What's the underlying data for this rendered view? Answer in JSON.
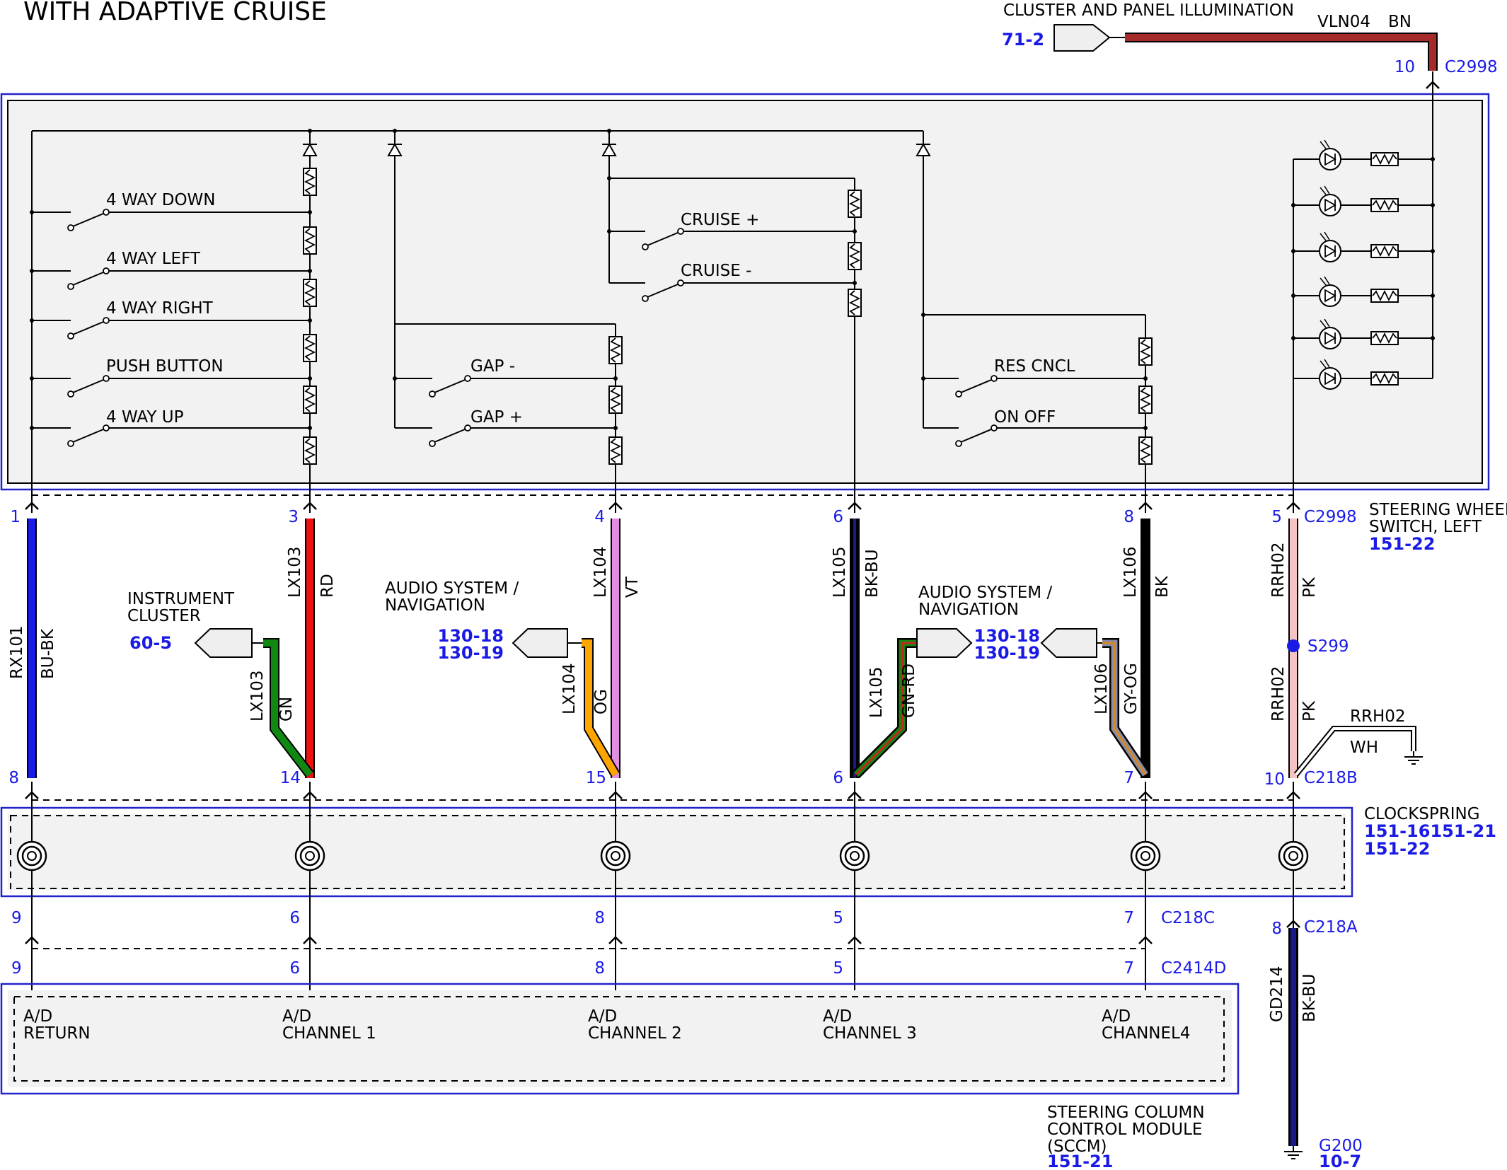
{
  "title": "WITH ADAPTIVE CRUISE",
  "illumination": {
    "label": "CLUSTER AND PANEL ILLUMINATION",
    "ref": "71-2",
    "circuit": "VLN04",
    "color": "BN",
    "pin": "10",
    "connector": "C2998"
  },
  "switches_left": [
    "4 WAY DOWN",
    "4 WAY LEFT",
    "4 WAY RIGHT",
    "PUSH BUTTON",
    "4 WAY UP"
  ],
  "switches_cruise": [
    "CRUISE +",
    "CRUISE -"
  ],
  "switches_gap": [
    "GAP -",
    "GAP +"
  ],
  "switches_res": [
    "RES CNCL",
    "ON OFF"
  ],
  "module": {
    "label_line1": "STEERING WHEEL",
    "label_line2": "SWITCH, LEFT",
    "ref": "151-22"
  },
  "top_pins": [
    "1",
    "3",
    "4",
    "6",
    "8"
  ],
  "top_conn": {
    "pin": "5",
    "name": "C2998"
  },
  "wires": [
    {
      "circuit": "RX101",
      "color": "BU-BK"
    },
    {
      "circuit": "LX103",
      "color": "RD"
    },
    {
      "circuit": "LX104",
      "color": "VT"
    },
    {
      "circuit": "LX105",
      "color": "BK-BU"
    },
    {
      "circuit": "LX106",
      "color": "BK"
    }
  ],
  "branches": [
    {
      "circuit": "LX103",
      "color": "GN",
      "dest1": "INSTRUMENT",
      "dest2": "CLUSTER",
      "ref1": "60-5",
      "ref2": ""
    },
    {
      "circuit": "LX104",
      "color": "OG",
      "dest1": "AUDIO SYSTEM /",
      "dest2": "NAVIGATION",
      "ref1": "130-18",
      "ref2": "130-19"
    },
    {
      "circuit": "LX105",
      "color": "GN-RD",
      "dest1": "AUDIO SYSTEM /",
      "dest2": "NAVIGATION",
      "ref1": "130-18",
      "ref2": "130-19"
    },
    {
      "circuit": "LX106",
      "color": "GY-OG",
      "dest1": "",
      "dest2": "",
      "ref1": "",
      "ref2": ""
    }
  ],
  "pk_wire": {
    "circuit_a": "RRH02",
    "color_a": "PK",
    "splice": "S299",
    "circuit_b": "RRH02",
    "color_b": "PK",
    "branch_circuit": "RRH02",
    "branch_color": "WH"
  },
  "bottom_pins": [
    "8",
    "14",
    "15",
    "6",
    "7"
  ],
  "c218b": {
    "pin": "10",
    "name": "C218B"
  },
  "clockspring": {
    "label": "CLOCKSPRING",
    "ref1": "151-16151-21",
    "ref2": "151-22"
  },
  "c218c_pins": [
    "9",
    "6",
    "8",
    "5",
    "7"
  ],
  "c218c": "C218C",
  "c218a": {
    "pin": "8",
    "name": "C218A"
  },
  "c2414d_pins": [
    "9",
    "6",
    "8",
    "5",
    "7"
  ],
  "c2414d": "C2414D",
  "sccm_channels": [
    {
      "l1": "A/D",
      "l2": "RETURN"
    },
    {
      "l1": "A/D",
      "l2": "CHANNEL 1"
    },
    {
      "l1": "A/D",
      "l2": "CHANNEL 2"
    },
    {
      "l1": "A/D",
      "l2": "CHANNEL 3"
    },
    {
      "l1": "A/D",
      "l2": "CHANNEL4"
    }
  ],
  "sccm": {
    "l1": "STEERING COLUMN",
    "l2": "CONTROL MODULE",
    "l3": "(SCCM)",
    "ref": "151-21"
  },
  "ground_wire": {
    "circuit": "GD214",
    "color": "BK-BU",
    "ground": "G200",
    "ref": "10-7"
  }
}
